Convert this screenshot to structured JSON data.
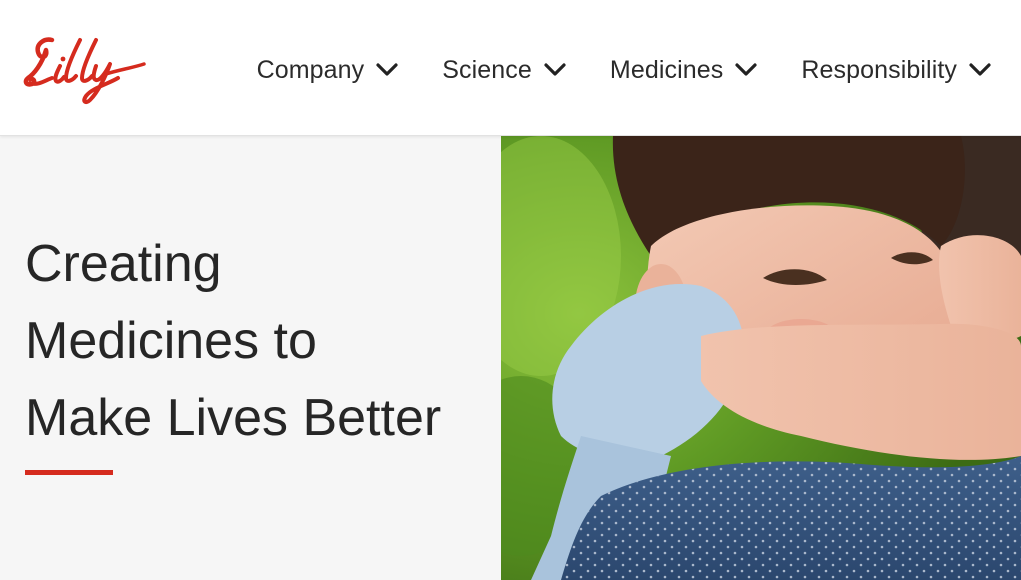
{
  "brand": {
    "logo_text": "Lilly",
    "logo_color": "#d52b1e"
  },
  "nav": {
    "items": [
      {
        "label": "Company",
        "icon": "chevron-down-icon"
      },
      {
        "label": "Science",
        "icon": "chevron-down-icon"
      },
      {
        "label": "Medicines",
        "icon": "chevron-down-icon"
      },
      {
        "label": "Responsibility",
        "icon": "chevron-down-icon"
      }
    ]
  },
  "hero": {
    "title_lines": [
      "Creating",
      "Medicines to",
      "Make Lives Better"
    ],
    "accent_color": "#d52b1e",
    "image_subject": "child hugging an adult outdoors"
  }
}
